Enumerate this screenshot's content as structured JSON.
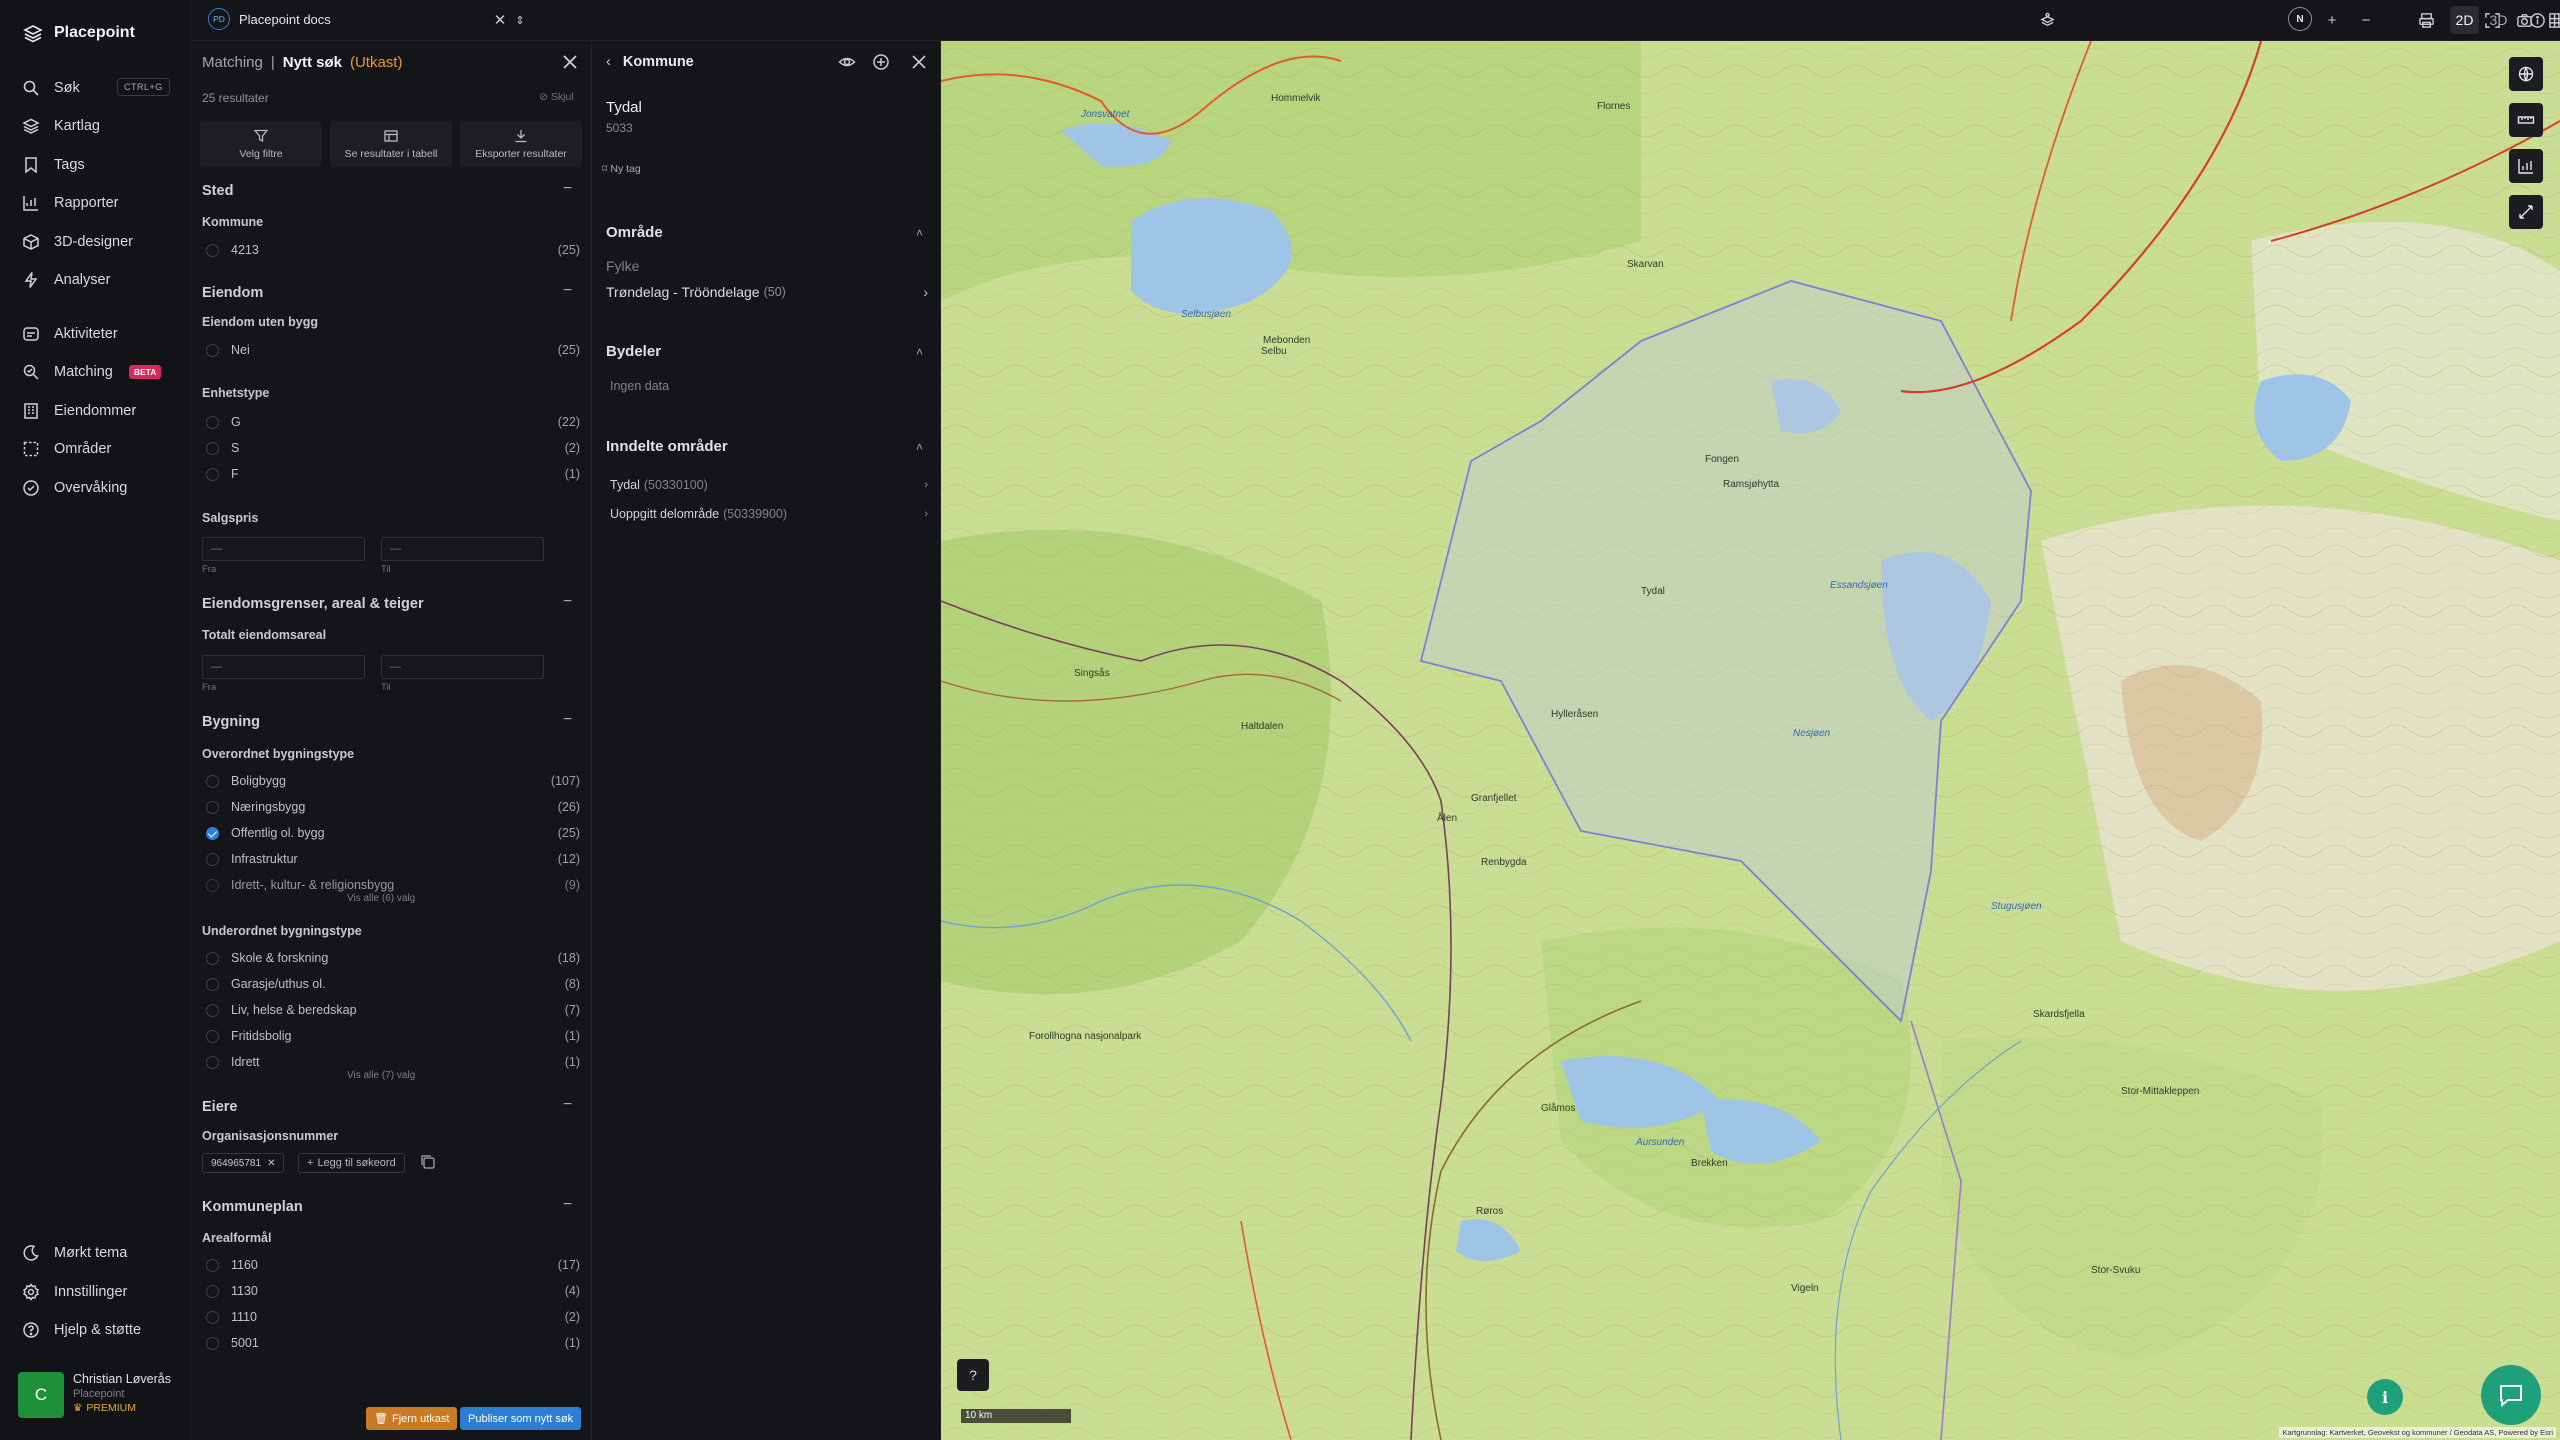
{
  "sidebar": {
    "brand": "Placepoint",
    "shortcut": "CTRL+G",
    "nav": [
      {
        "label": "Søk",
        "icon": "search-icon"
      },
      {
        "label": "Kartlag",
        "icon": "layers-icon"
      },
      {
        "label": "Tags",
        "icon": "bookmark-icon"
      },
      {
        "label": "Rapporter",
        "icon": "chart-icon"
      },
      {
        "label": "3D-designer",
        "icon": "cube-icon"
      },
      {
        "label": "Analyser",
        "icon": "bolt-icon"
      },
      {
        "label": "Aktiviteter",
        "icon": "activity-icon"
      },
      {
        "label": "Matching",
        "icon": "matching-icon"
      },
      {
        "label": "Eiendommer",
        "icon": "building-icon"
      },
      {
        "label": "Områder",
        "icon": "area-icon"
      },
      {
        "label": "Overvåking",
        "icon": "monitor-icon"
      }
    ],
    "beta_badge": "BETA",
    "bottom_nav": [
      {
        "label": "Mørkt tema",
        "icon": "moon-icon"
      },
      {
        "label": "Innstillinger",
        "icon": "settings-icon"
      },
      {
        "label": "Hjelp & støtte",
        "icon": "help-icon"
      }
    ],
    "user": {
      "initial": "C",
      "name": "Christian Løverås",
      "org": "Placepoint",
      "plan": "PREMIUM"
    }
  },
  "topbar": {
    "project_initials": "PD",
    "project_name": "Placepoint docs",
    "compass": "N",
    "view_2d": "2D",
    "view_3d": "3D"
  },
  "filter": {
    "crumb": "Matching",
    "separator": "|",
    "title": "Nytt søk",
    "status": "(Utkast)",
    "results": "25 resultater",
    "hide": "Skjul",
    "actions": [
      "Velg filtre",
      "Se resultater i tabell",
      "Eksporter resultater"
    ],
    "sections": {
      "sted": "Sted",
      "eiendom": "Eiendom",
      "grenser": "Eiendomsgrenser, areal & teiger",
      "bygning": "Bygning",
      "eiere": "Eiere",
      "kommuneplan": "Kommuneplan"
    },
    "kommune_label": "Kommune",
    "kommune_items": [
      {
        "label": "4213",
        "count": "(25)"
      }
    ],
    "uten_bygg_label": "Eiendom uten bygg",
    "uten_bygg_items": [
      {
        "label": "Nei",
        "count": "(25)"
      }
    ],
    "enhetstype_label": "Enhetstype",
    "enhetstype_items": [
      {
        "label": "G",
        "count": "(22)"
      },
      {
        "label": "S",
        "count": "(2)"
      },
      {
        "label": "F",
        "count": "(1)"
      }
    ],
    "salgspris_label": "Salgspris",
    "areal_label": "Totalt eiendomsareal",
    "range_placeholder": "—",
    "from": "Fra",
    "to": "Til",
    "overordnet_label": "Overordnet bygningstype",
    "overordnet_items": [
      {
        "label": "Boligbygg",
        "count": "(107)",
        "checked": false
      },
      {
        "label": "Næringsbygg",
        "count": "(26)",
        "checked": false
      },
      {
        "label": "Offentlig ol. bygg",
        "count": "(25)",
        "checked": true
      },
      {
        "label": "Infrastruktur",
        "count": "(12)",
        "checked": false
      },
      {
        "label": "Idrett-, kultur- & religionsbygg",
        "count": "(9)",
        "checked": false
      }
    ],
    "overordnet_show_all": "Vis alle (6) valg",
    "underordnet_label": "Underordnet bygningstype",
    "underordnet_items": [
      {
        "label": "Skole & forskning",
        "count": "(18)"
      },
      {
        "label": "Garasje/uthus ol.",
        "count": "(8)"
      },
      {
        "label": "Liv, helse & beredskap",
        "count": "(7)"
      },
      {
        "label": "Fritidsbolig",
        "count": "(1)"
      },
      {
        "label": "Idrett",
        "count": "(1)"
      }
    ],
    "underordnet_show_all": "Vis alle (7) valg",
    "org_label": "Organisasjonsnummer",
    "org_chip": "964965781",
    "add_keyword": "Legg til søkeord",
    "arealformal_label": "Arealformål",
    "arealformal_items": [
      {
        "label": "1160",
        "count": "(17)"
      },
      {
        "label": "1130",
        "count": "(4)"
      },
      {
        "label": "1110",
        "count": "(2)"
      },
      {
        "label": "5001",
        "count": "(1)"
      }
    ],
    "remove_draft": "Fjern utkast",
    "publish": "Publiser som nytt søk"
  },
  "detail": {
    "header": "Kommune",
    "name": "Tydal",
    "code": "5033",
    "tag": "Ny tag",
    "area_section": "Område",
    "fylke_label": "Fylke",
    "fylke_value": "Trøndelag - Trööndelage",
    "fylke_count": "(50)",
    "bydeler_section": "Bydeler",
    "bydeler_empty": "Ingen data",
    "inndelte_section": "Inndelte områder",
    "inndelte_items": [
      {
        "label": "Tydal",
        "code": "(50330100)"
      },
      {
        "label": "Uoppgitt delområde",
        "code": "(50339900)"
      }
    ]
  },
  "map": {
    "scale": "10 km",
    "attribution": "Kartgrunnlag: Kartverket, Geovekst og kommuner / Geodata AS, Powered by Esri",
    "places": [
      "Flornes",
      "Hommelvik",
      "Jonsvatnet",
      "Selbusjøen",
      "Selbu",
      "Mebonden",
      "Skarvan",
      "Tydal",
      "Fongen",
      "Ramsjøhytta",
      "Stugusjøen",
      "Essandsjøen",
      "Nesjøen",
      "Brekken",
      "Ålen",
      "Haltdalen",
      "Singsås",
      "Renbygda",
      "Røros",
      "Glåmos",
      "Aursunden",
      "Forollhogna nasjonalpark",
      "Skardsfjella",
      "Stor-Mittakleppen",
      "Stor-Svuku",
      "Hylleråsen",
      "Granfjellet",
      "Vigeln"
    ]
  }
}
